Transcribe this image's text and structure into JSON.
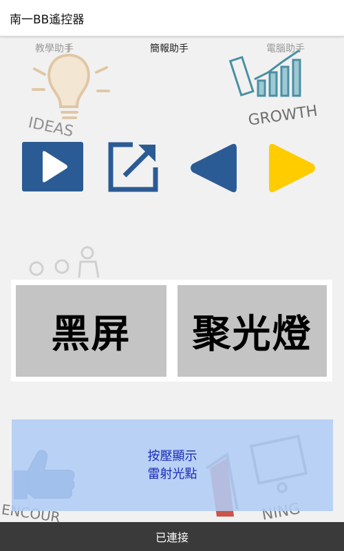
{
  "app": {
    "title": "南一BB遙控器"
  },
  "tabs": [
    {
      "label": "教學助手",
      "active": false
    },
    {
      "label": "簡報助手",
      "active": true
    },
    {
      "label": "電腦助手",
      "active": false
    }
  ],
  "background_words": {
    "ideas": "IDEAS",
    "growth": "GROWTH",
    "encourage": "ENCOUR",
    "learning": "NING"
  },
  "controls": {
    "play_color": "#2b5b94",
    "exit_color": "#2b5b94",
    "prev_color": "#2b5b94",
    "next_color": "#ffcc00"
  },
  "big_buttons": {
    "black_screen": "黑屏",
    "spotlight": "聚光燈"
  },
  "laser": {
    "line1": "按壓顯示",
    "line2": "雷射光點"
  },
  "status": {
    "text": "已連接"
  }
}
